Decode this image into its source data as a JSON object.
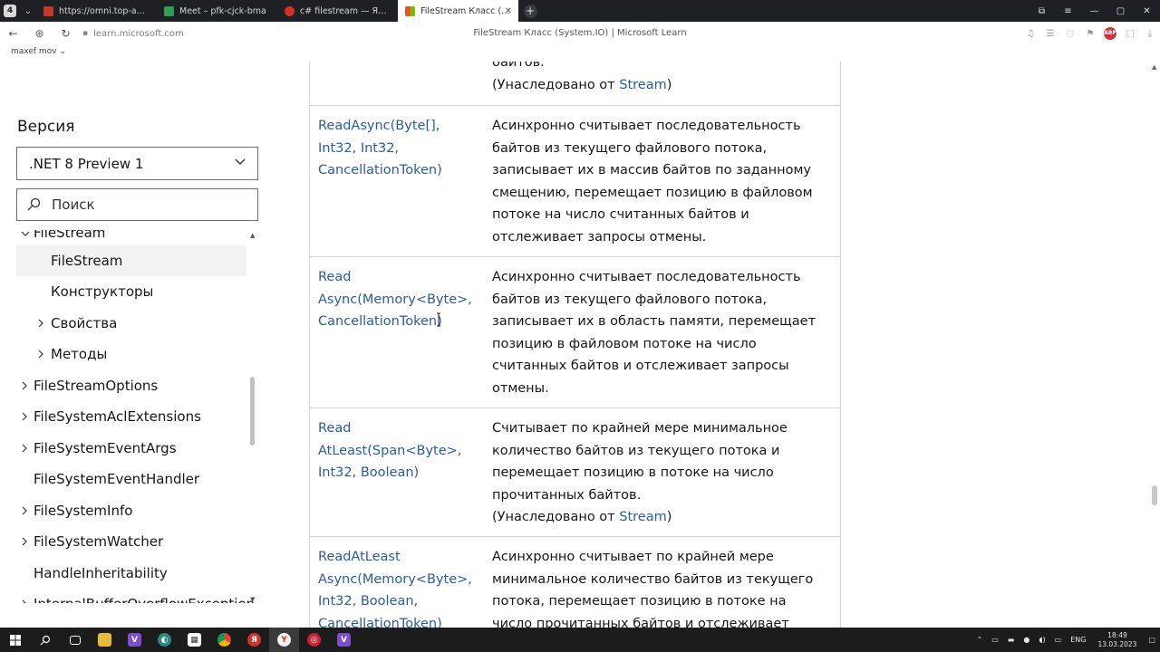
{
  "browser": {
    "tabs": [
      {
        "label": "https://omni.top-academ",
        "favicon_color": "#c0392b",
        "active": false
      },
      {
        "label": "Meet – pfk-cjck-bma",
        "favicon_color": "#2e9d57",
        "active": false
      },
      {
        "label": "c# filestream — Яндекс: н",
        "favicon_color": "#d6302c",
        "active": false
      },
      {
        "label": "FileStream Класс (Syste",
        "favicon_color": "#1e88e5",
        "active": true
      }
    ],
    "url": "learn.microsoft.com",
    "page_title": "FileStream Класс (System.IO) | Microsoft Learn",
    "bookmark": "maxef mov ⌄"
  },
  "sidebar": {
    "version_title": "Версия",
    "version_selected": ".NET 8 Preview 1",
    "search_placeholder": "Поиск",
    "toc": [
      {
        "label": "FileStream",
        "indent": 1,
        "arrow": "down",
        "selected": false,
        "cut": true
      },
      {
        "label": "FileStream",
        "indent": 2,
        "arrow": "none",
        "selected": true
      },
      {
        "label": "Конструкторы",
        "indent": 2,
        "arrow": "none",
        "selected": false
      },
      {
        "label": "Свойства",
        "indent": 2,
        "arrow": "right",
        "selected": false
      },
      {
        "label": "Методы",
        "indent": 2,
        "arrow": "right",
        "selected": false
      },
      {
        "label": "FileStreamOptions",
        "indent": 1,
        "arrow": "right",
        "selected": false
      },
      {
        "label": "FileSystemAclExtensions",
        "indent": 1,
        "arrow": "right",
        "selected": false
      },
      {
        "label": "FileSystemEventArgs",
        "indent": 1,
        "arrow": "right",
        "selected": false
      },
      {
        "label": "FileSystemEventHandler",
        "indent": 1,
        "arrow": "none",
        "selected": false
      },
      {
        "label": "FileSystemInfo",
        "indent": 1,
        "arrow": "right",
        "selected": false
      },
      {
        "label": "FileSystemWatcher",
        "indent": 1,
        "arrow": "right",
        "selected": false
      },
      {
        "label": "HandleInheritability",
        "indent": 1,
        "arrow": "none",
        "selected": false
      },
      {
        "label": "InternalBufferOverflowException",
        "indent": 1,
        "arrow": "right",
        "selected": false,
        "cut": true
      }
    ]
  },
  "methods": {
    "top_partial": {
      "desc_lines": [
        "байтов."
      ],
      "inherited_prefix": "(Унаследовано от ",
      "inherited_link": "Stream",
      "inherited_suffix": ")"
    },
    "rows": [
      {
        "name_lines": [
          "ReadAsync(Byte[],",
          "Int32, Int32,",
          "CancellationToken)"
        ],
        "desc_lines": [
          "Асинхронно считывает последовательность",
          "байтов из текущего файлового потока,",
          "записывает их в массив байтов по заданному",
          "смещению, перемещает позицию в файловом",
          "потоке на число считанных байтов и",
          "отслеживает запросы отмены."
        ],
        "inherited": false
      },
      {
        "name_lines": [
          "Read",
          "Async(Memory<Byte>,",
          "CancellationToken)"
        ],
        "desc_lines": [
          "Асинхронно считывает последовательность",
          "байтов из текущего файлового потока,",
          "записывает их в область памяти, перемещает",
          "позицию в файловом потоке на число",
          "считанных байтов и отслеживает запросы",
          "отмены."
        ],
        "inherited": false
      },
      {
        "name_lines": [
          "Read",
          "AtLeast(Span<Byte>,",
          "Int32, Boolean)"
        ],
        "desc_lines": [
          "Считывает по крайней мере минимальное",
          "количество байтов из текущего потока и",
          "перемещает позицию в потоке на число",
          "прочитанных байтов."
        ],
        "inherited": true,
        "inherited_prefix": "(Унаследовано от ",
        "inherited_link": "Stream",
        "inherited_suffix": ")"
      },
      {
        "name_lines": [
          "ReadAtLeast",
          "Async(Memory<Byte>,",
          "Int32, Boolean,",
          "CancellationToken)"
        ],
        "desc_lines": [
          "Асинхронно считывает по крайней мере",
          "минимальное количество байтов из текущего",
          "потока, перемещает позицию в потоке на",
          "число прочитанных байтов и отслеживает"
        ],
        "inherited": false
      }
    ]
  },
  "taskbar": {
    "time": "18:49",
    "date": "13.03.2023",
    "lang": "ENG"
  }
}
